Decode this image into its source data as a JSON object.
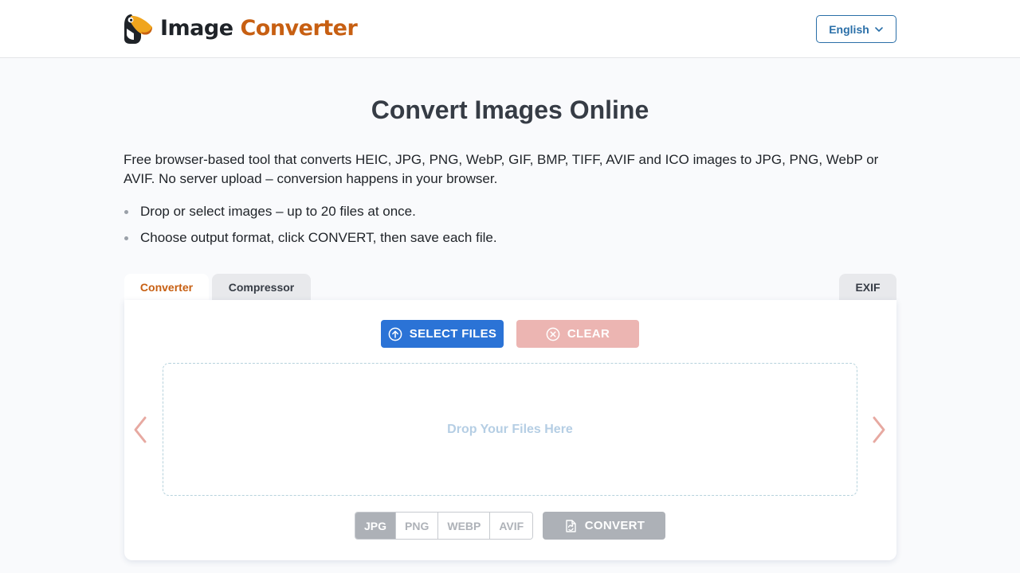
{
  "header": {
    "logo_word1": "Image",
    "logo_word2": "Converter",
    "language": "English"
  },
  "page": {
    "title": "Convert Images Online",
    "intro": "Free browser-based tool that converts HEIC, JPG, PNG, WebP, GIF, BMP, TIFF, AVIF and ICO images to JPG, PNG, WebP or AVIF. No server upload – conversion happens in your browser.",
    "bullets": [
      "Drop or select images – up to 20 files at once.",
      "Choose output format, click CONVERT, then save each file."
    ]
  },
  "tabs": {
    "converter": "Converter",
    "compressor": "Compressor",
    "exif": "EXIF",
    "active": "Converter"
  },
  "converter": {
    "select_label": "SELECT FILES",
    "clear_label": "CLEAR",
    "dropzone_text": "Drop Your Files Here",
    "formats": [
      "JPG",
      "PNG",
      "WEBP",
      "AVIF"
    ],
    "selected_format": "JPG",
    "convert_label": "CONVERT"
  },
  "colors": {
    "accent_orange": "#c75f12",
    "primary_blue": "#2b73d6",
    "clear_disabled": "#ecb5b2",
    "convert_disabled": "#adb1b7",
    "arrow": "#e7a9a1"
  },
  "icons": {
    "logo": "toucan-logo-icon",
    "language": "chevron-down-icon",
    "select": "upload-circle-icon",
    "clear": "close-circle-icon",
    "prev": "chevron-left-icon",
    "next": "chevron-right-icon",
    "convert": "convert-file-icon"
  }
}
